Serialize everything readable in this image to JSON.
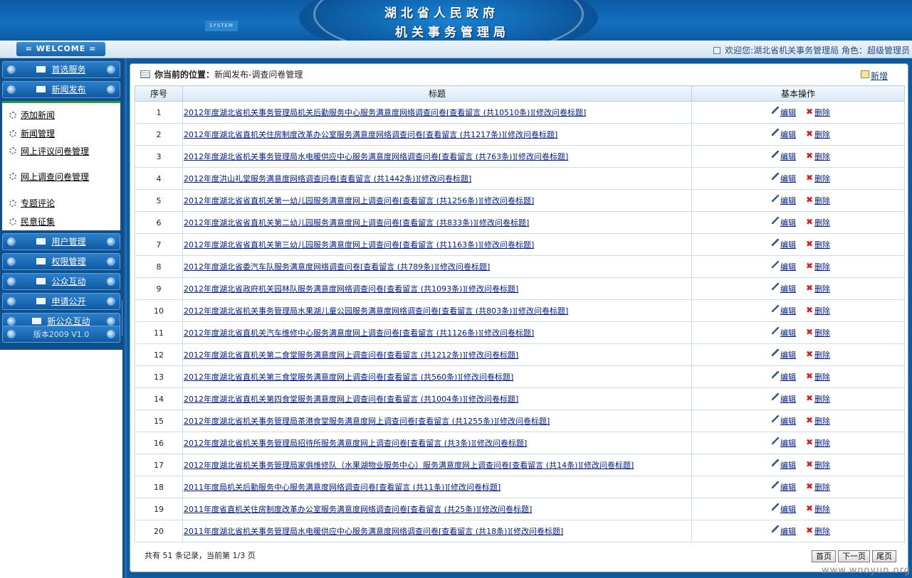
{
  "header": {
    "title_line1": "湖北省人民政府",
    "title_line2": "机关事务管理局",
    "system_tag": "SYSTEM"
  },
  "welcome_bar": {
    "tab_label": "= WELCOME =",
    "user_info": "欢迎您:湖北省机关事务管理局 角色：超级管理员"
  },
  "sidebar": {
    "menus": [
      {
        "label": "首选服务"
      },
      {
        "label": "新闻发布"
      }
    ],
    "submenu_items": [
      {
        "label": "添加新闻"
      },
      {
        "label": "新闻管理"
      },
      {
        "label": "网上评议问卷管理"
      },
      {
        "label": "网上调查问卷管理"
      },
      {
        "label": "专题评论"
      },
      {
        "label": "民意征集"
      }
    ],
    "menus_bottom": [
      {
        "label": "用户管理"
      },
      {
        "label": "权限管理"
      },
      {
        "label": "公众互动"
      },
      {
        "label": "申请公开"
      },
      {
        "label": "新公众互动"
      }
    ],
    "version": "版本2009 V1.0"
  },
  "main": {
    "breadcrumb_label": "你当前的位置：",
    "breadcrumb_path": "新闻发布-调查问卷管理",
    "add_label": "新增",
    "table": {
      "headers": [
        "序号",
        "标题",
        "基本操作"
      ],
      "edit_label": "编辑",
      "delete_label": "删除",
      "rows": [
        {
          "no": "1",
          "title": "2012年度湖北省机关事务管理局机关后勤服务中心服务满意度网络调查问卷[查看留言 (共10510条)][修改问卷标题]"
        },
        {
          "no": "2",
          "title": "2012年度湖北省直机关住房制度改革办公室服务满意度网络调查问卷[查看留言 (共1217条)][修改问卷标题]"
        },
        {
          "no": "3",
          "title": "2012年度湖北省机关事务管理局水电暖供应中心服务满意度网络调查问卷[查看留言 (共763条)][修改问卷标题]"
        },
        {
          "no": "4",
          "title": "2012年度洪山礼堂服务满意度网络调查问卷[查看留言 (共1442条)][修改问卷标题]"
        },
        {
          "no": "5",
          "title": "2012年度湖北省省直机关第一幼儿园服务满意度网上调查问卷[查看留言 (共1256条)][修改问卷标题]"
        },
        {
          "no": "6",
          "title": "2012年度湖北省省直机关第二幼儿园服务满意度网上调查问卷[查看留言 (共833条)][修改问卷标题]"
        },
        {
          "no": "7",
          "title": "2012年度湖北省省直机关第三幼儿园服务满意度网上调查问卷[查看留言 (共1163条)][修改问卷标题]"
        },
        {
          "no": "8",
          "title": "2012年度湖北省委汽车队服务满意度网络调查问卷[查看留言 (共789条)][修改问卷标题]"
        },
        {
          "no": "9",
          "title": "2012年度湖北省政府机关园林队服务满意度网络调查问卷[查看留言 (共1093条)][修改问卷标题]"
        },
        {
          "no": "10",
          "title": "2012年度湖北省机关事务管理局水果湖儿童公园服务满意度网络调查问卷[查看留言 (共803条)][修改问卷标题]"
        },
        {
          "no": "11",
          "title": "2012年度湖北省直机关汽车维修中心服务满意度网上调查问卷[查看留言 (共1126条)][修改问卷标题]"
        },
        {
          "no": "12",
          "title": "2012年度湖北省直机关第二食堂服务满意度网上调查问卷[查看留言 (共1212条)][修改问卷标题]"
        },
        {
          "no": "13",
          "title": "2012年度湖北省直机关第三食堂服务满意度网上调查问卷[查看留言 (共560条)][修改问卷标题]"
        },
        {
          "no": "14",
          "title": "2012年度湖北省直机关第四食堂服务满意度网上调查问卷[查看留言 (共1004条)][修改问卷标题]"
        },
        {
          "no": "15",
          "title": "2012年度湖北省机关事务管理局茶港食堂服务满意度网上调查问卷[查看留言 (共1255条)][修改问卷标题]"
        },
        {
          "no": "16",
          "title": "2012年度湖北省机关事务管理局招待所服务满意度网上调查问卷[查看留言 (共3条)][修改问卷标题]"
        },
        {
          "no": "17",
          "title": "2012年度湖北省机关事务管理局家俱维修队（水果湖物业服务中心）服务满意度网上调查问卷[查看留言 (共14条)][修改问卷标题]"
        },
        {
          "no": "18",
          "title": "2011年度局机关后勤服务中心服务满意度网络调查问卷[查看留言 (共11条)][修改问卷标题]"
        },
        {
          "no": "19",
          "title": "2011年度省直机关住房制度改革办公室服务满意度网络调查问卷[查看留言 (共25条)][修改问卷标题]"
        },
        {
          "no": "20",
          "title": "2011年度湖北省机关事务管理局水电暖供应中心服务满意度网络调查问卷[查看留言 (共18条)][修改问卷标题]"
        }
      ]
    },
    "footer_info": "共有 51 条记录，当前第 1/3 页",
    "pager": {
      "first": "首页",
      "next": "下一页",
      "last": "尾页"
    }
  },
  "watermark": "www.wooyun.org"
}
